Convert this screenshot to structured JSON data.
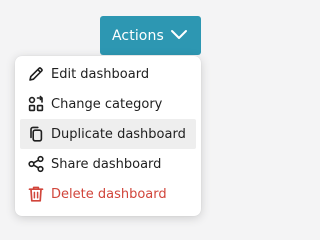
{
  "actions_button": {
    "label": "Actions",
    "icon": "chevron-down-icon",
    "color": "#2d97b2"
  },
  "menu": {
    "items": [
      {
        "label": "Edit dashboard",
        "icon": "pencil-icon",
        "highlighted": false,
        "danger": false
      },
      {
        "label": "Change category",
        "icon": "category-icon",
        "highlighted": false,
        "danger": false
      },
      {
        "label": "Duplicate dashboard",
        "icon": "duplicate-icon",
        "highlighted": true,
        "danger": false
      },
      {
        "label": "Share dashboard",
        "icon": "share-icon",
        "highlighted": false,
        "danger": false
      },
      {
        "label": "Delete dashboard",
        "icon": "trash-icon",
        "highlighted": false,
        "danger": true
      }
    ],
    "danger_color": "#d1453b",
    "highlight_color": "#eeeeee"
  }
}
